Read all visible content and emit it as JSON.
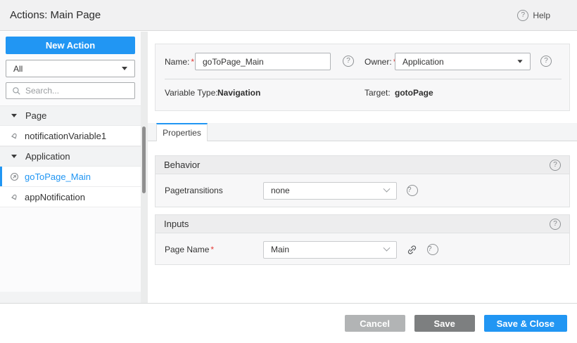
{
  "header": {
    "title": "Actions: Main Page",
    "help_label": "Help"
  },
  "icons": {
    "help_glyph": "?"
  },
  "required_mark": "*",
  "sidebar": {
    "new_action_label": "New Action",
    "filter_value": "All",
    "search_placeholder": "Search...",
    "tree": [
      {
        "type": "group",
        "label": "Page"
      },
      {
        "type": "item",
        "label": "notificationVariable1",
        "icon": "notification",
        "selected": false
      },
      {
        "type": "group",
        "label": "Application"
      },
      {
        "type": "item",
        "label": "goToPage_Main",
        "icon": "goto-page",
        "selected": true
      },
      {
        "type": "item",
        "label": "appNotification",
        "icon": "notification",
        "selected": false
      }
    ]
  },
  "form": {
    "name_label": "Name:",
    "name_value": "goToPage_Main",
    "owner_label": "Owner:",
    "owner_value": "Application",
    "variable_type_label": "Variable Type:",
    "variable_type_value": "Navigation",
    "target_label": "Target:",
    "target_value": "gotoPage"
  },
  "tabs": [
    {
      "label": "Properties",
      "active": true
    }
  ],
  "sections": [
    {
      "title": "Behavior",
      "rows": [
        {
          "label": "Pagetransitions",
          "value": "none",
          "required": false
        }
      ]
    },
    {
      "title": "Inputs",
      "rows": [
        {
          "label": "Page Name",
          "value": "Main",
          "required": true
        }
      ]
    }
  ],
  "footer": {
    "cancel_label": "Cancel",
    "save_label": "Save",
    "save_close_label": "Save & Close"
  },
  "colors": {
    "accent_blue": "#2196f3",
    "cancel_gray": "#b2b4b5",
    "save_gray": "#7d7f80",
    "required_red": "#e53935"
  }
}
